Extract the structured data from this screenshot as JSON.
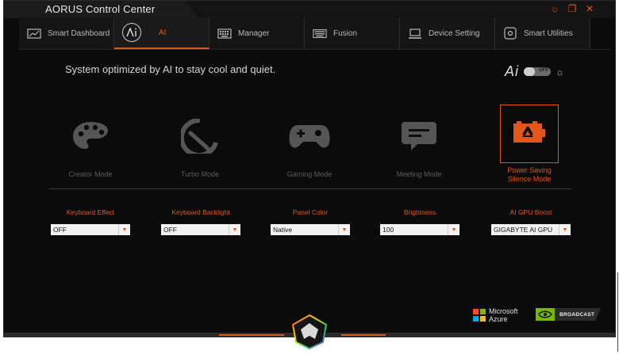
{
  "app": {
    "title": "AORUS Control Center",
    "window_controls": {
      "settings_glyph": "☼",
      "restore_glyph": "❐",
      "close_glyph": "✕"
    }
  },
  "tabs": [
    {
      "label": "Smart Dashboard",
      "icon": "dashboard-icon",
      "active": false
    },
    {
      "label": "AI",
      "icon": "ai-icon",
      "active": true
    },
    {
      "label": "Manager",
      "icon": "keyboard-icon",
      "active": false
    },
    {
      "label": "Fusion",
      "icon": "fusion-keyboard-icon",
      "active": false
    },
    {
      "label": "Device Setting",
      "icon": "laptop-icon",
      "active": false
    },
    {
      "label": "Smart Utilities",
      "icon": "utilities-icon",
      "active": false
    }
  ],
  "ai_panel": {
    "headline": "System optimized by AI to stay cool and quiet.",
    "ai_logo": "Ai",
    "toggle_state": "OFF"
  },
  "modes": [
    {
      "label": "Creator Mode",
      "icon": "palette-icon",
      "selected": false
    },
    {
      "label": "Turbo Mode",
      "icon": "speedometer-icon",
      "selected": false
    },
    {
      "label": "Gaming Mode",
      "icon": "gamepad-icon",
      "selected": false
    },
    {
      "label": "Meeting Mode",
      "icon": "chat-bubble-icon",
      "selected": false
    },
    {
      "label": "Power Saving\nSilence Mode",
      "icon": "eco-battery-icon",
      "selected": true
    }
  ],
  "settings": [
    {
      "label": "Keyboard Effect",
      "value": "OFF"
    },
    {
      "label": "Keyboard Backlight",
      "value": "OFF"
    },
    {
      "label": "Panel Color",
      "value": "Native"
    },
    {
      "label": "Brightness",
      "value": "100"
    },
    {
      "label": "AI GPU Boost",
      "value": "GIGABYTE AI GPU"
    }
  ],
  "footer": {
    "microsoft_logo_line1": "Microsoft",
    "microsoft_logo_line2": "Azure",
    "nvidia_broadcast": "BROADCAST",
    "nvidia_small": "NVIDIA"
  },
  "colors": {
    "accent": "#e2561b",
    "background": "#0b0b0b",
    "inactive_text": "#5c5c5c"
  }
}
